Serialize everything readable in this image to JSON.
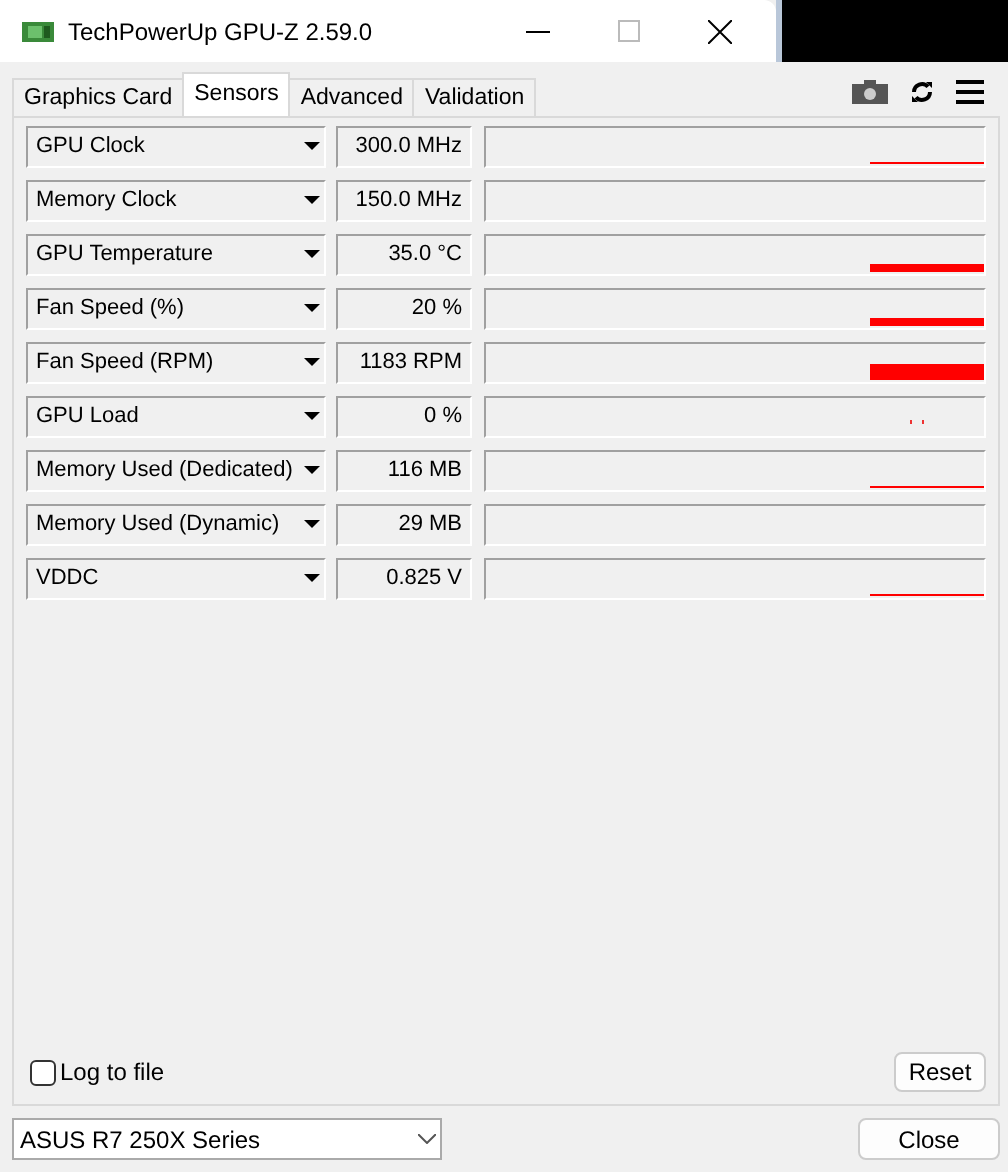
{
  "window": {
    "title": "TechPowerUp GPU-Z 2.59.0"
  },
  "tabs": [
    {
      "label": "Graphics Card",
      "selected": false
    },
    {
      "label": "Sensors",
      "selected": true
    },
    {
      "label": "Advanced",
      "selected": false
    },
    {
      "label": "Validation",
      "selected": false
    }
  ],
  "sensors": [
    {
      "name": "GPU Clock",
      "value": "300.0 MHz",
      "kind": "thin"
    },
    {
      "name": "Memory Clock",
      "value": "150.0 MHz",
      "kind": "none"
    },
    {
      "name": "GPU Temperature",
      "value": "35.0 °C",
      "kind": "thick"
    },
    {
      "name": "Fan Speed (%)",
      "value": "20 %",
      "kind": "thick"
    },
    {
      "name": "Fan Speed (RPM)",
      "value": "1183 RPM",
      "kind": "full"
    },
    {
      "name": "GPU Load",
      "value": "0 %",
      "kind": "dots"
    },
    {
      "name": "Memory Used (Dedicated)",
      "value": "116 MB",
      "kind": "thin"
    },
    {
      "name": "Memory Used (Dynamic)",
      "value": "29 MB",
      "kind": "none"
    },
    {
      "name": "VDDC",
      "value": "0.825 V",
      "kind": "thin"
    }
  ],
  "log_to_file": {
    "label": "Log to file",
    "checked": false
  },
  "reset_button": "Reset",
  "device_select": {
    "value": "ASUS R7 250X Series"
  },
  "close_button": "Close"
}
